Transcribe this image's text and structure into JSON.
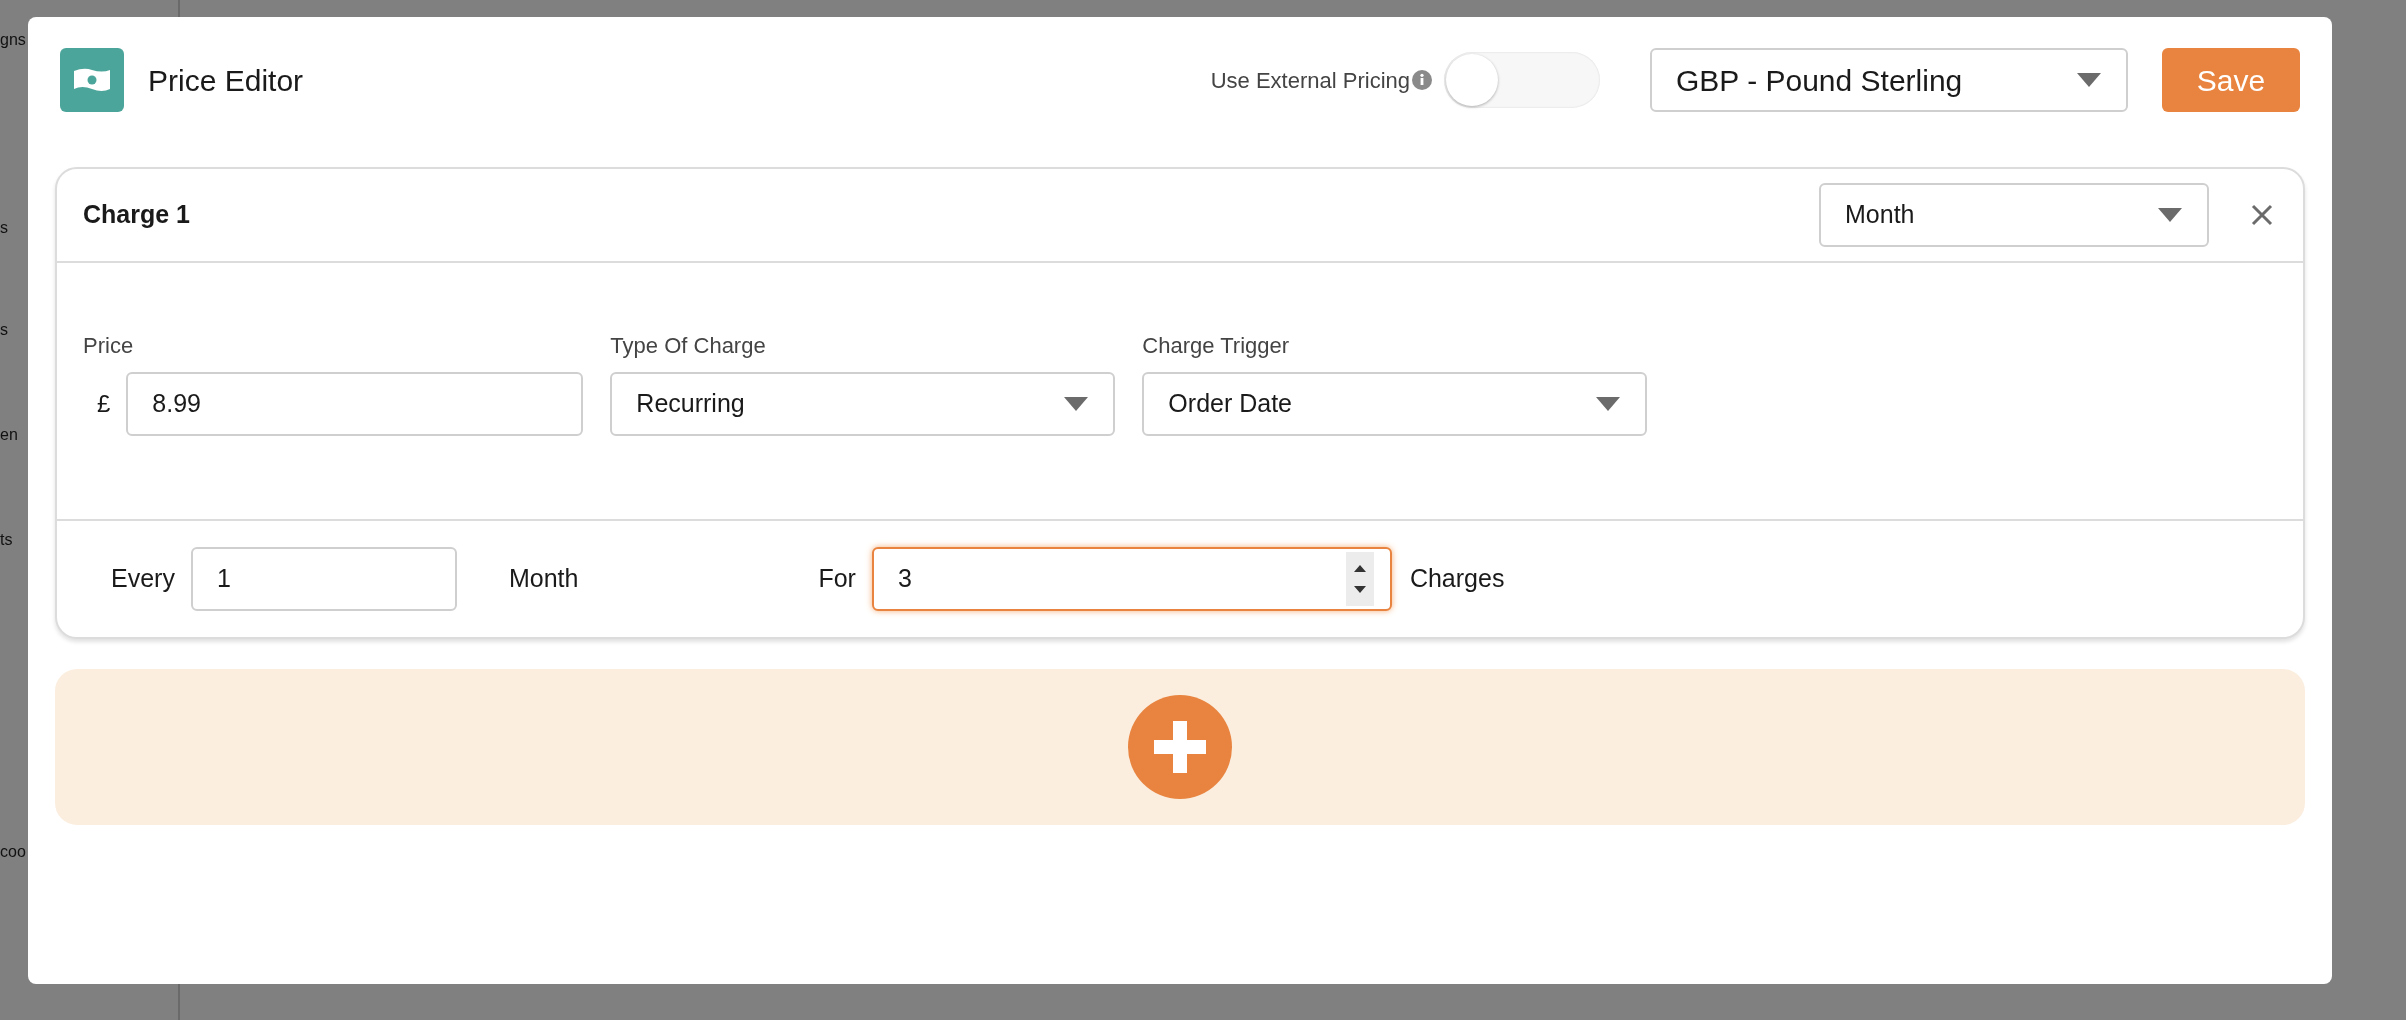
{
  "background": {
    "sidebar_fragments": [
      "gns",
      "s",
      "s",
      "en",
      "ts",
      "coo"
    ]
  },
  "dialog": {
    "title": "Price Editor",
    "external_pricing": {
      "label": "Use External Pricing",
      "on": false
    },
    "currency": {
      "value": "GBP - Pound Sterling"
    },
    "save": "Save",
    "charges": [
      {
        "title": "Charge 1",
        "period": "Month",
        "price": {
          "label": "Price",
          "symbol": "£",
          "value": "8.99"
        },
        "type_of_charge": {
          "label": "Type Of Charge",
          "value": "Recurring"
        },
        "charge_trigger": {
          "label": "Charge Trigger",
          "value": "Order Date"
        },
        "every": {
          "label": "Every",
          "value": "1",
          "unit": "Month",
          "focused": false
        },
        "for": {
          "label": "For",
          "value": "3",
          "unit": "Charges",
          "focused": true
        }
      }
    ]
  }
}
